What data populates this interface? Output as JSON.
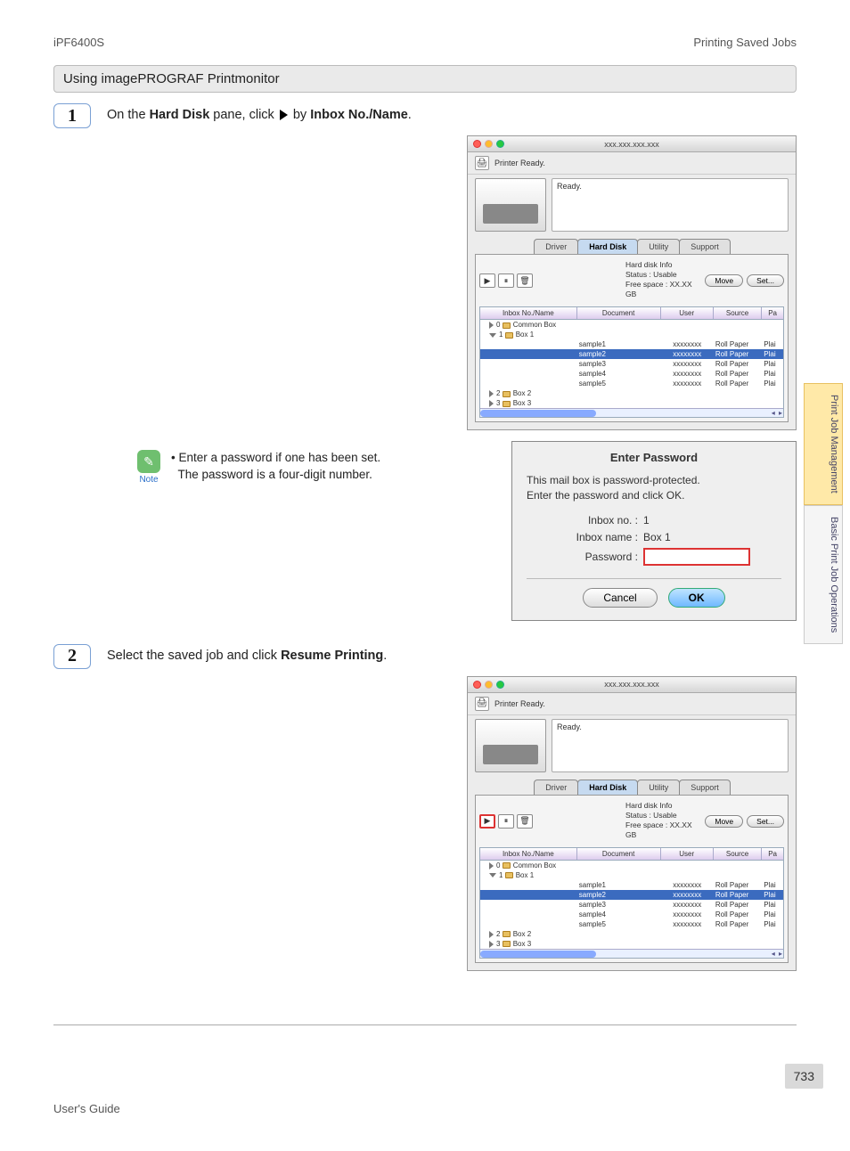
{
  "header": {
    "product": "iPF6400S",
    "breadcrumb": "Printing Saved Jobs"
  },
  "section_title": "Using imagePROGRAF Printmonitor",
  "steps": {
    "s1": {
      "num": "1",
      "prefix": "On the ",
      "bold1": "Hard Disk",
      "mid": " pane, click ",
      "suffix": " by ",
      "bold2": "Inbox No./Name",
      "end": "."
    },
    "s2": {
      "num": "2",
      "prefix": "Select the saved job and click ",
      "bold1": "Resume Printing",
      "end": "."
    }
  },
  "note": {
    "label": "Note",
    "line1": "Enter a password if one has been set.",
    "line2": "The password is a four-digit number."
  },
  "printmonitor": {
    "title": "xxx.xxx.xxx.xxx",
    "ready_label": "Printer Ready.",
    "status_word": "Ready.",
    "tabs": {
      "t1": "Driver",
      "t2": "Hard Disk",
      "t3": "Utility",
      "t4": "Support"
    },
    "hdinfo": {
      "label": "Hard disk Info",
      "status": "Status : Usable",
      "free": "Free space : XX.XX GB"
    },
    "btn_move": "Move",
    "btn_set": "Set...",
    "cols": {
      "c1": "Inbox No./Name",
      "c2": "Document",
      "c3": "User",
      "c4": "Source",
      "c5": "Pa"
    },
    "tree": {
      "row0": {
        "idx": "0",
        "name": "Common Box"
      },
      "row1": {
        "idx": "1",
        "name": "Box 1"
      },
      "row2": {
        "idx": "2",
        "name": "Box 2"
      },
      "row3": {
        "idx": "3",
        "name": "Box 3"
      }
    },
    "jobs": [
      {
        "doc": "sample1",
        "user": "xxxxxxxx",
        "src": "Roll Paper",
        "pa": "Plai"
      },
      {
        "doc": "sample2",
        "user": "xxxxxxxx",
        "src": "Roll Paper",
        "pa": "Plai"
      },
      {
        "doc": "sample3",
        "user": "xxxxxxxx",
        "src": "Roll Paper",
        "pa": "Plai"
      },
      {
        "doc": "sample4",
        "user": "xxxxxxxx",
        "src": "Roll Paper",
        "pa": "Plai"
      },
      {
        "doc": "sample5",
        "user": "xxxxxxxx",
        "src": "Roll Paper",
        "pa": "Plai"
      }
    ]
  },
  "dialog": {
    "title": "Enter Password",
    "msg1": "This mail box is password-protected.",
    "msg2": "Enter the password and click OK.",
    "inbox_no_label": "Inbox no. :",
    "inbox_no_val": "1",
    "inbox_name_label": "Inbox name :",
    "inbox_name_val": "Box 1",
    "pw_label": "Password :",
    "cancel": "Cancel",
    "ok": "OK"
  },
  "side": {
    "tab1": "Print Job Management",
    "tab2": "Basic Print Job Operations"
  },
  "footer": {
    "guide": "User's Guide",
    "page": "733"
  }
}
